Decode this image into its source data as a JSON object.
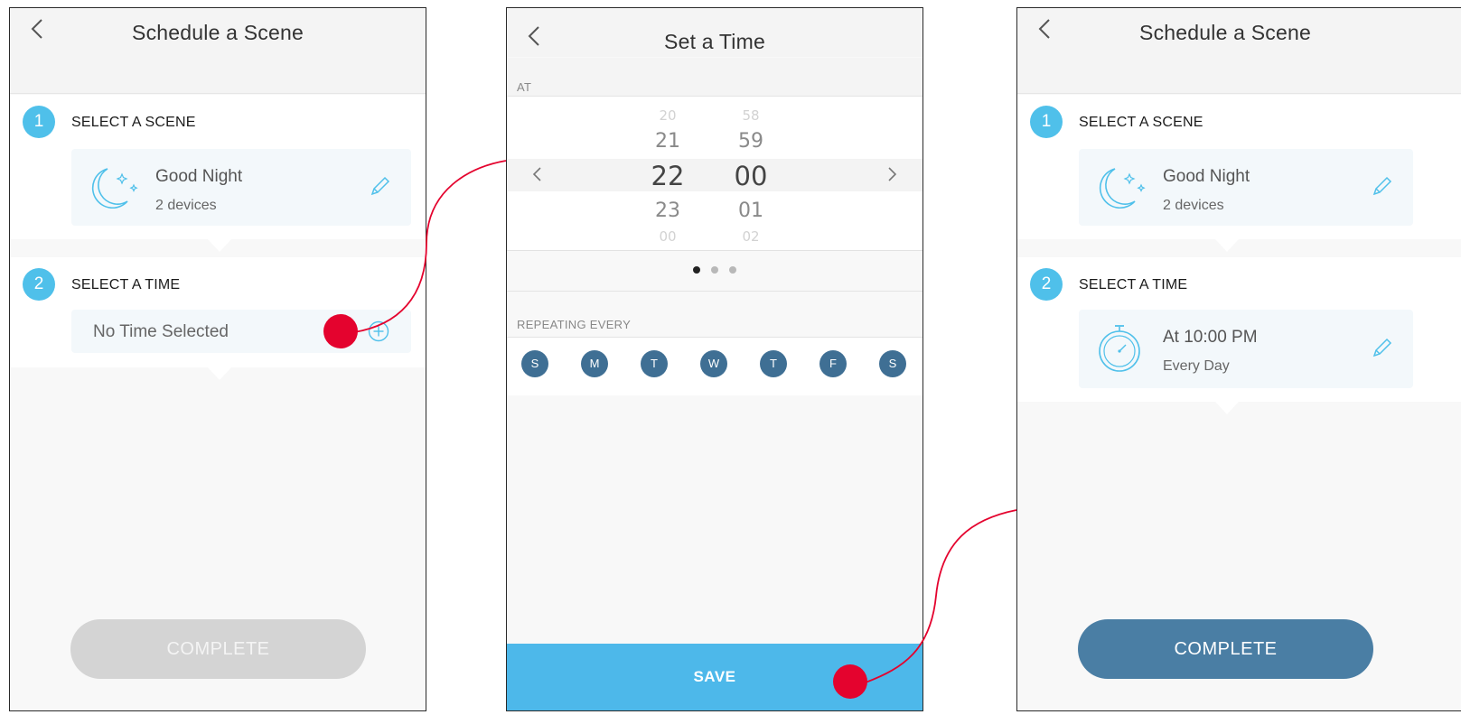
{
  "screen1": {
    "title": "Schedule a Scene",
    "section1": {
      "number": "1",
      "label": "SELECT A SCENE"
    },
    "scene_card": {
      "name": "Good Night",
      "devices": "2 devices"
    },
    "section2": {
      "number": "2",
      "label": "SELECT A TIME"
    },
    "time_card": {
      "placeholder": "No Time Selected"
    },
    "complete_label": "COMPLETE"
  },
  "screen2": {
    "title": "Set a Time",
    "at_label": "AT",
    "hours": [
      "20",
      "21",
      "22",
      "23",
      "00"
    ],
    "minutes": [
      "58",
      "59",
      "00",
      "01",
      "02"
    ],
    "repeat_label": "REPEATING EVERY",
    "days": [
      "S",
      "M",
      "T",
      "W",
      "T",
      "F",
      "S"
    ],
    "save_label": "SAVE"
  },
  "screen3": {
    "title": "Schedule a Scene",
    "section1": {
      "number": "1",
      "label": "SELECT A SCENE"
    },
    "scene_card": {
      "name": "Good Night",
      "devices": "2 devices"
    },
    "section2": {
      "number": "2",
      "label": "SELECT A TIME"
    },
    "time_card": {
      "time": "At 10:00 PM",
      "repeat": "Every Day"
    },
    "complete_label": "COMPLETE"
  },
  "colors": {
    "accent_blue": "#4fc0ea",
    "complete_active": "#4a7ea4",
    "complete_disabled": "#d4d4d4",
    "day_circle": "#3f6f94",
    "save_bar": "#4db8ea",
    "annotation_red": "#e4032e"
  },
  "icons": [
    "back-chevron-icon",
    "moon-stars-icon",
    "pencil-icon",
    "plus-circle-icon",
    "stopwatch-icon",
    "chevron-left-icon",
    "chevron-right-icon"
  ]
}
